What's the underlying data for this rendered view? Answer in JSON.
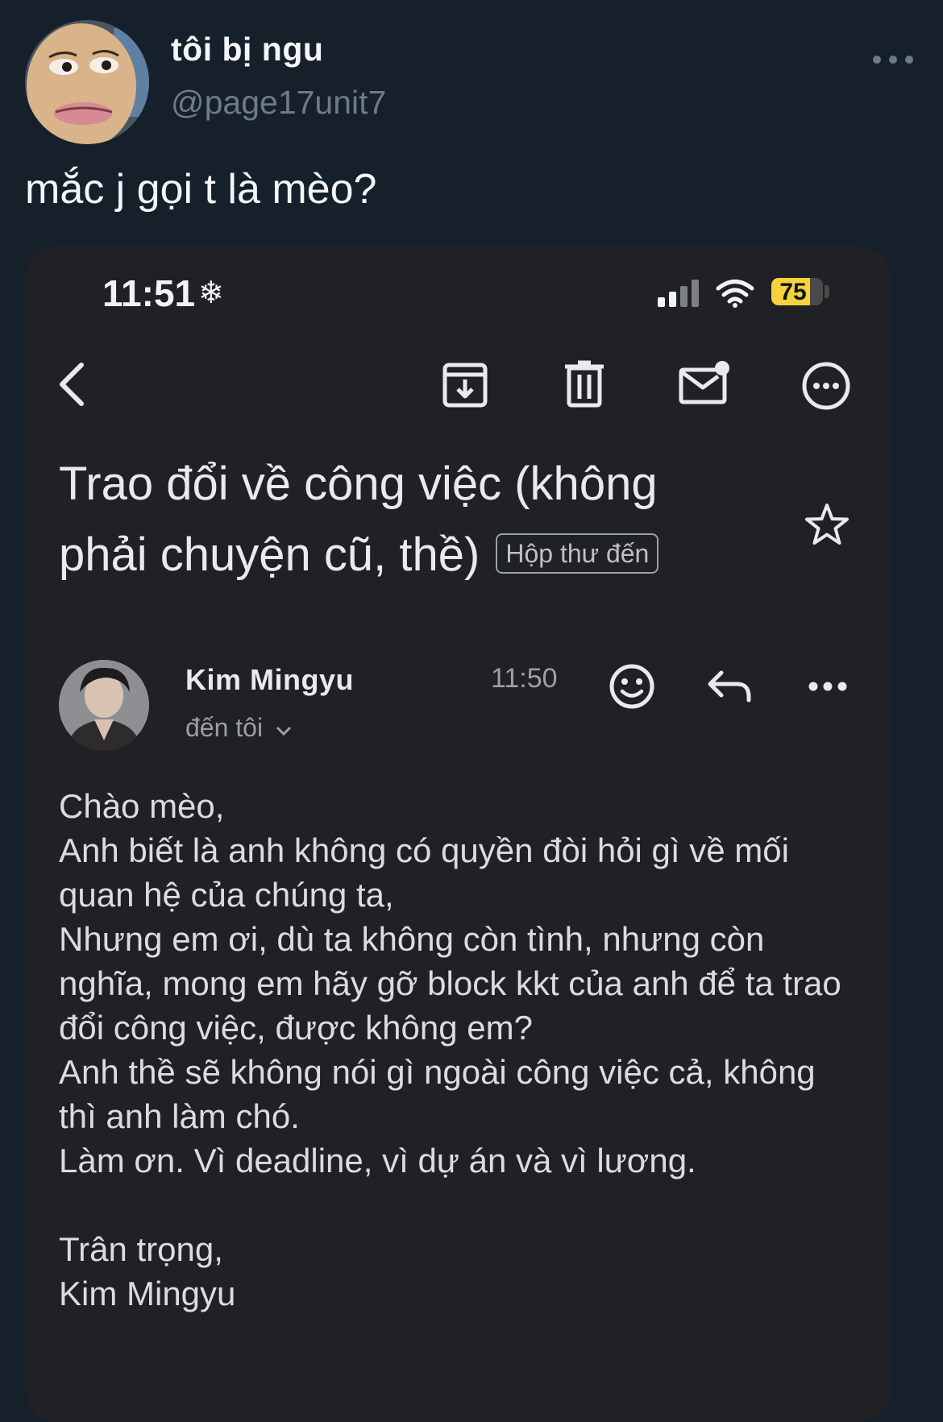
{
  "tweet": {
    "display_name": "tôi bị ngu",
    "handle": "@page17unit7",
    "text": "mắc j gọi t là mèo?"
  },
  "phone": {
    "status": {
      "time": "11:51",
      "battery": "75",
      "battery_level_percent": 75,
      "battery_color": "#f6d33c"
    },
    "toolbar": {
      "icons": [
        "back-icon",
        "archive-icon",
        "trash-icon",
        "mark-unread-icon",
        "more-options-icon"
      ]
    },
    "email": {
      "subject": "Trao đổi về công việc (không phải chuyện cũ, thề)",
      "label": "Hộp thư đến",
      "sender": "Kim Mingyu",
      "recipient": "đến tôi",
      "time": "11:50",
      "body_lines": [
        "Chào mèo,",
        "Anh biết là anh không có quyền đòi hỏi gì về mối quan hệ của chúng ta,",
        "Nhưng em ơi, dù ta không còn tình, nhưng còn nghĩa, mong em hãy gỡ block kkt của anh để ta trao đổi công việc, được không em?",
        "Anh thề sẽ không nói gì ngoài công việc cả, không thì anh làm chó.",
        "Làm ơn. Vì deadline, vì dự án và vì lương."
      ],
      "signoff": "Trân trọng,",
      "signature": "Kim Mingyu"
    }
  },
  "colors": {
    "page_background": "#15202b",
    "email_background": "#202124"
  }
}
